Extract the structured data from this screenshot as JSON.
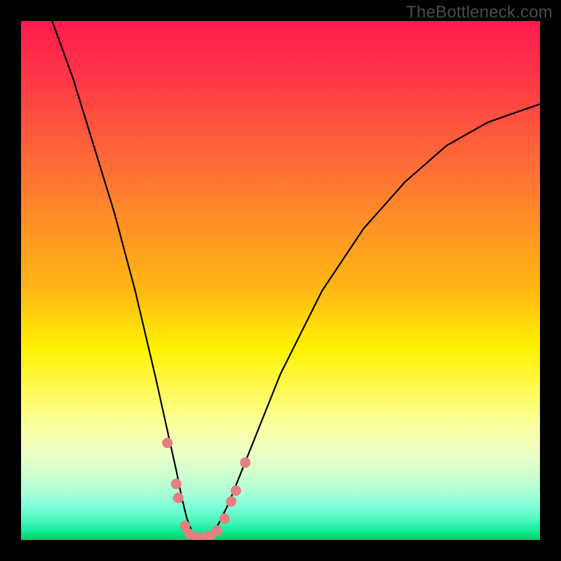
{
  "watermark": "TheBottleneck.com",
  "chart_data": {
    "type": "line",
    "title": "",
    "xlabel": "",
    "ylabel": "",
    "xlim": [
      0,
      100
    ],
    "ylim": [
      0,
      100
    ],
    "grid": false,
    "legend": false,
    "series": [
      {
        "name": "bottleneck-curve",
        "x": [
          6,
          10,
          14,
          18,
          22,
          26,
          28,
          30,
          31,
          32,
          33,
          34,
          35,
          36,
          37,
          38,
          40,
          44,
          50,
          58,
          66,
          74,
          82,
          90,
          100
        ],
        "y": [
          100,
          89,
          76,
          63,
          48,
          31,
          22,
          13,
          8,
          4,
          1.5,
          0.5,
          0.5,
          0.8,
          1.5,
          3,
          7,
          17,
          32,
          48,
          60,
          69,
          76,
          80.5,
          84
        ]
      }
    ],
    "markers": [
      {
        "name": "left-high",
        "x": 28.2,
        "y": 18.7
      },
      {
        "name": "left-mid-1",
        "x": 29.9,
        "y": 10.8
      },
      {
        "name": "left-mid-2",
        "x": 30.3,
        "y": 8.1
      },
      {
        "name": "bottom-1",
        "x": 31.6,
        "y": 2.7
      },
      {
        "name": "bottom-2",
        "x": 32.4,
        "y": 1.2
      },
      {
        "name": "bottom-3",
        "x": 33.8,
        "y": 0.5
      },
      {
        "name": "bottom-4",
        "x": 35.1,
        "y": 0.5
      },
      {
        "name": "bottom-5",
        "x": 36.5,
        "y": 0.8
      },
      {
        "name": "bottom-6",
        "x": 37.8,
        "y": 1.8
      },
      {
        "name": "right-low",
        "x": 39.2,
        "y": 4.1
      },
      {
        "name": "right-mid-1",
        "x": 40.5,
        "y": 7.4
      },
      {
        "name": "right-mid-2",
        "x": 41.4,
        "y": 9.5
      },
      {
        "name": "right-high",
        "x": 43.2,
        "y": 14.9
      }
    ],
    "marker_color": "#e48080",
    "curve_color": "#000000"
  }
}
